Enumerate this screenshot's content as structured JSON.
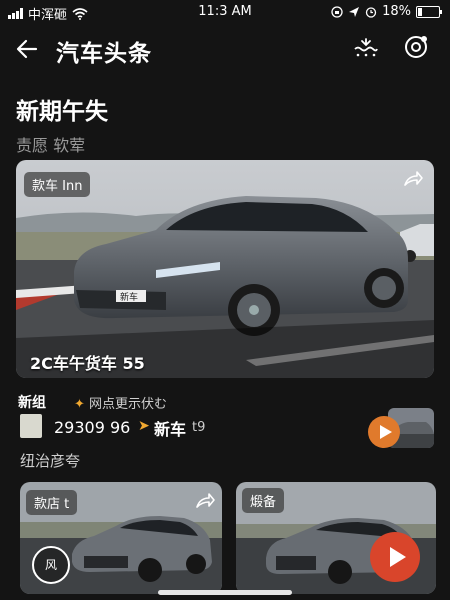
{
  "status_bar": {
    "carrier": "中浑砸",
    "time": "11:3 AM",
    "battery": "18%"
  },
  "header": {
    "title": "汽车头条"
  },
  "section": {
    "title": "新期午失",
    "subtitle": "责愿 软荤"
  },
  "hero": {
    "tag": "款车 Inn",
    "plate": "新车",
    "caption": "2C车午货车 55"
  },
  "row_item": {
    "tag": "新组",
    "status": "网点更示伏む",
    "number": "29309 96",
    "label": "新车",
    "label_suffix": "t9",
    "bottom_text": "纽治彦夸"
  },
  "card_left": {
    "tag": "款店 t",
    "bubble": "风"
  },
  "card_right": {
    "tag": "煅备"
  },
  "colors": {
    "background": "#141414",
    "accent_orange": "#e07a2c",
    "accent_red": "#d9452b"
  }
}
